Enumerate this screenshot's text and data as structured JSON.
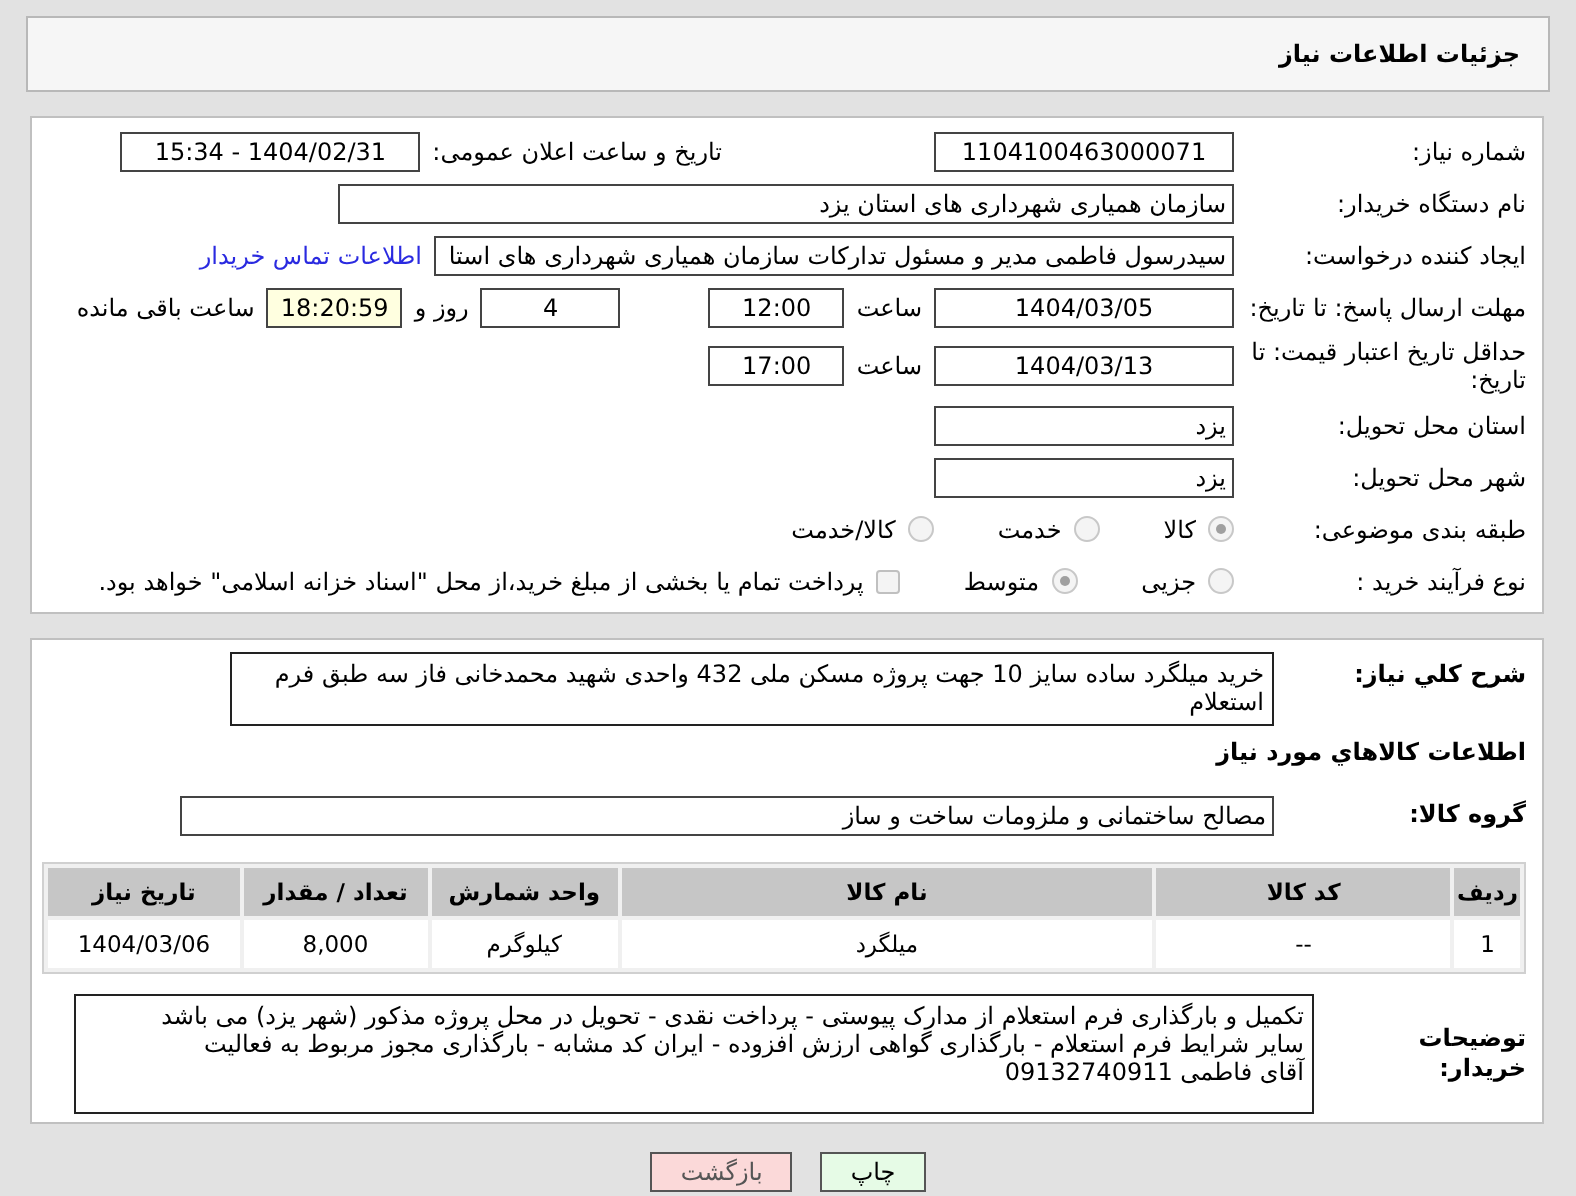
{
  "header": {
    "title": "جزئیات اطلاعات نیاز"
  },
  "need_number": {
    "label": "شماره نیاز:",
    "value": "1104100463000071"
  },
  "announce": {
    "label": "تاریخ و ساعت اعلان عمومی:",
    "value": "1404/02/31 - 15:34"
  },
  "buyer_org": {
    "label": "نام دستگاه خریدار:",
    "value": "سازمان همیاری شهرداری های استان یزد"
  },
  "creator": {
    "label": "ایجاد کننده درخواست:",
    "value": "سیدرسول فاطمی مدیر و مسئول تدارکات سازمان همیاری شهرداری های استا",
    "link": "اطلاعات تماس خریدار"
  },
  "deadline": {
    "label": "مهلت ارسال پاسخ: تا تاریخ:",
    "date": "1404/03/05",
    "time_label": "ساعت",
    "time": "12:00",
    "days": "4",
    "days_label": "روز و",
    "remaining": "18:20:59",
    "remaining_label": "ساعت باقی مانده"
  },
  "validity": {
    "label": "حداقل تاریخ اعتبار قیمت: تا تاریخ:",
    "date": "1404/03/13",
    "time_label": "ساعت",
    "time": "17:00"
  },
  "province": {
    "label": "استان محل تحویل:",
    "value": "یزد"
  },
  "city": {
    "label": "شهر محل تحویل:",
    "value": "یزد"
  },
  "category": {
    "label": "طبقه بندی موضوعی:",
    "options": [
      {
        "label": "کالا",
        "selected": true
      },
      {
        "label": "خدمت",
        "selected": false
      },
      {
        "label": "کالا/خدمت",
        "selected": false
      }
    ]
  },
  "process": {
    "label": "نوع فرآیند خرید :",
    "options": [
      {
        "label": "جزیی",
        "selected": false
      },
      {
        "label": "متوسط",
        "selected": true
      }
    ],
    "payment": {
      "label": "پرداخت تمام یا بخشی از مبلغ خرید،از محل \"اسناد خزانه اسلامی\" خواهد بود.",
      "checked": false
    }
  },
  "description": {
    "label": "شرح کلي نياز:",
    "value": "خرید میلگرد ساده سایز 10 جهت پروژه مسکن ملی 432 واحدی شهید محمدخانی فاز سه طبق فرم استعلام"
  },
  "goods_heading": "اطلاعات کالاهاي مورد نياز",
  "group": {
    "label": "گروه کالا:",
    "value": "مصالح ساختمانی و ملزومات ساخت و ساز"
  },
  "table": {
    "columns": [
      "ردیف",
      "کد کالا",
      "نام کالا",
      "واحد شمارش",
      "تعداد / مقدار",
      "تاریخ نیاز"
    ],
    "rows": [
      [
        "1",
        "--",
        "میلگرد",
        "کیلوگرم",
        "8,000",
        "1404/03/06"
      ]
    ]
  },
  "notes": {
    "label": "توضیحات خریدار:",
    "lines": [
      "تکمیل و بارگذاری فرم استعلام از مدارک پیوستی - پرداخت نقدی - تحویل در محل پروژه مذکور (شهر یزد) می باشد",
      "سایر شرایط فرم استعلام - بارگذاری گواهی ارزش افزوده - ایران کد مشابه - بارگذاری مجوز مربوط به فعالیت",
      "آقای فاطمی 09132740911"
    ]
  },
  "buttons": [
    {
      "label": "چاپ",
      "kind": "print"
    },
    {
      "label": "بازگشت",
      "kind": "back"
    }
  ]
}
